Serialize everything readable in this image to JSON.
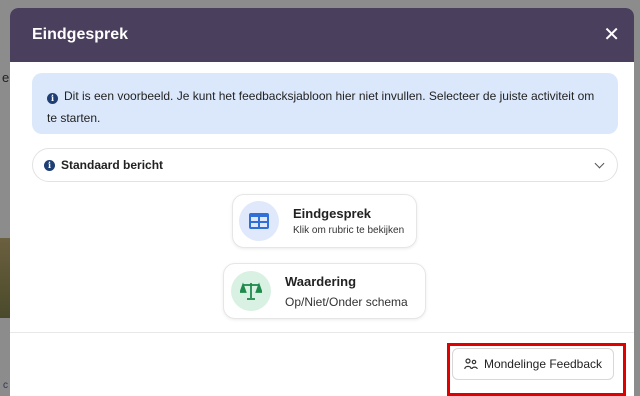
{
  "modal": {
    "title": "Eindgesprek",
    "close_label": "✕"
  },
  "info_banner": {
    "text": "Dit is een voorbeeld. Je kunt het feedbacksjabloon hier niet invullen. Selecteer de juiste activiteit om te starten."
  },
  "dropdown": {
    "label": "Standaard bericht"
  },
  "cards": [
    {
      "title": "Eindgesprek",
      "subtitle": "Klik om rubric te bekijken",
      "icon": "table-icon"
    },
    {
      "title": "Waardering",
      "subtitle": "Op/Niet/Onder schema",
      "icon": "scale-icon"
    }
  ],
  "footer": {
    "button_label": "Mondelinge Feedback",
    "button_icon": "people-talk-icon"
  },
  "colors": {
    "header_bg": "#4a3f5c",
    "banner_bg": "#dbe8fb",
    "blue_icon": "#2f6fd6",
    "green_icon": "#1e8a4c",
    "highlight": "#e00000"
  }
}
